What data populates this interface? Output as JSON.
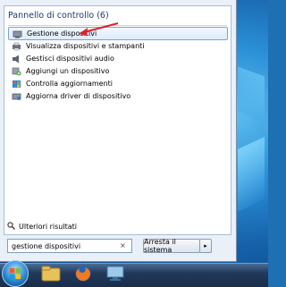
{
  "start_menu": {
    "header": "Pannello di controllo (6)",
    "results": [
      {
        "label": "Gestione dispositivi",
        "icon": "device-manager-icon",
        "selected": true
      },
      {
        "label": "Visualizza dispositivi e stampanti",
        "icon": "printer-icon",
        "selected": false
      },
      {
        "label": "Gestisci dispositivi audio",
        "icon": "speaker-icon",
        "selected": false
      },
      {
        "label": "Aggiungi un dispositivo",
        "icon": "add-device-icon",
        "selected": false
      },
      {
        "label": "Controlla aggiornamenti",
        "icon": "update-icon",
        "selected": false
      },
      {
        "label": "Aggiorna driver di dispositivo",
        "icon": "driver-icon",
        "selected": false
      }
    ],
    "more_results": "Ulteriori risultati",
    "search_value": "gestione dispositivi",
    "search_clear": "×",
    "shutdown_label": "Arresta il sistema",
    "shutdown_arrow": "▸"
  },
  "taskbar": {
    "items": [
      "start-orb",
      "explorer-icon",
      "firefox-icon",
      "remote-desktop-icon"
    ]
  },
  "colors": {
    "selection_border": "#7da2ce",
    "annotation_arrow": "#d9262a",
    "header_text": "#1e3a66"
  }
}
